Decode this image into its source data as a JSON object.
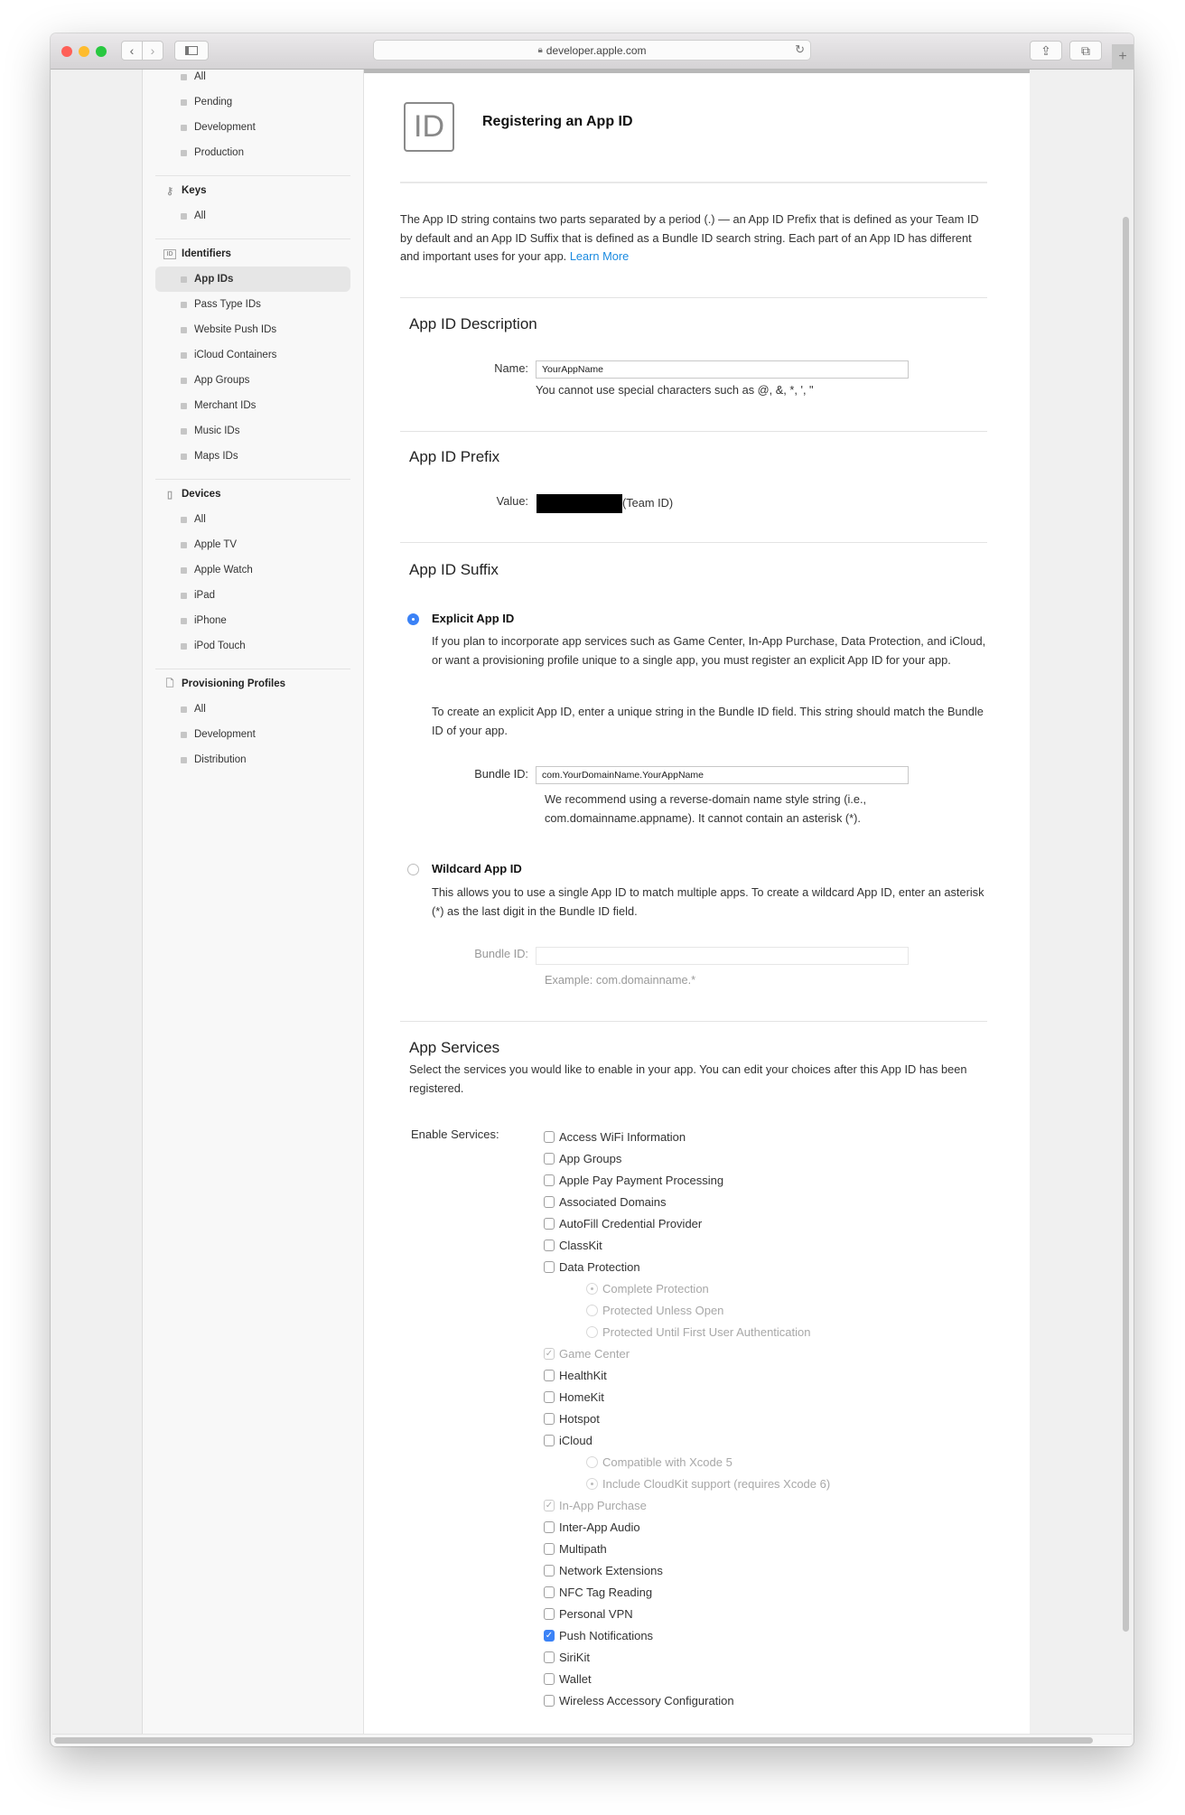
{
  "browser": {
    "url": "developer.apple.com",
    "lock_icon": "lock-icon",
    "colors": {
      "close": "#fe5f57",
      "minimize": "#febc2e",
      "zoom": "#28c840"
    }
  },
  "sidebar": {
    "top_items": [
      "All",
      "Pending",
      "Development",
      "Production"
    ],
    "sections": [
      {
        "title": "Keys",
        "icon": "key-icon",
        "items": [
          "All"
        ]
      },
      {
        "title": "Identifiers",
        "icon": "id-icon",
        "items": [
          "App IDs",
          "Pass Type IDs",
          "Website Push IDs",
          "iCloud Containers",
          "App Groups",
          "Merchant IDs",
          "Music IDs",
          "Maps IDs"
        ],
        "active": "App IDs"
      },
      {
        "title": "Devices",
        "icon": "device-icon",
        "items": [
          "All",
          "Apple TV",
          "Apple Watch",
          "iPad",
          "iPhone",
          "iPod Touch"
        ]
      },
      {
        "title": "Provisioning Profiles",
        "icon": "document-icon",
        "items": [
          "All",
          "Development",
          "Distribution"
        ]
      }
    ]
  },
  "main": {
    "icon_text": "ID",
    "title": "Registering an App ID",
    "intro": "The App ID string contains two parts separated by a period (.) — an App ID Prefix that is defined as your Team ID by default and an App ID Suffix that is defined as a Bundle ID search string. Each part of an App ID has different and important uses for your app.",
    "learn_more": "Learn More",
    "description": {
      "heading": "App ID Description",
      "name_label": "Name:",
      "name_value": "YourAppName",
      "hint": "You cannot use special characters such as @, &, *, ', \""
    },
    "prefix": {
      "heading": "App ID Prefix",
      "value_label": "Value:",
      "team_suffix": "(Team ID)"
    },
    "suffix": {
      "heading": "App ID Suffix",
      "explicit": {
        "label": "Explicit App ID",
        "selected": true,
        "para1": "If you plan to incorporate app services such as Game Center, In-App Purchase, Data Protection, and iCloud, or want a provisioning profile unique to a single app, you must register an explicit App ID for your app.",
        "para2": "To create an explicit App ID, enter a unique string in the Bundle ID field. This string should match the Bundle ID of your app.",
        "bundle_label": "Bundle ID:",
        "bundle_value": "com.YourDomainName.YourAppName",
        "hint": "We recommend using a reverse-domain name style string (i.e., com.domainname.appname). It cannot contain an asterisk (*)."
      },
      "wildcard": {
        "label": "Wildcard App ID",
        "selected": false,
        "para": "This allows you to use a single App ID to match multiple apps. To create a wildcard App ID, enter an asterisk (*) as the last digit in the Bundle ID field.",
        "bundle_label": "Bundle ID:",
        "bundle_value": "",
        "example": "Example: com.domainname.*"
      }
    },
    "services": {
      "heading": "App Services",
      "description": "Select the services you would like to enable in your app. You can edit your choices after this App ID has been registered.",
      "enable_label": "Enable Services:",
      "items": [
        {
          "label": "Access WiFi Information",
          "type": "checkbox",
          "checked": false,
          "disabled": false
        },
        {
          "label": "App Groups",
          "type": "checkbox",
          "checked": false,
          "disabled": false
        },
        {
          "label": "Apple Pay Payment Processing",
          "type": "checkbox",
          "checked": false,
          "disabled": false
        },
        {
          "label": "Associated Domains",
          "type": "checkbox",
          "checked": false,
          "disabled": false
        },
        {
          "label": "AutoFill Credential Provider",
          "type": "checkbox",
          "checked": false,
          "disabled": false
        },
        {
          "label": "ClassKit",
          "type": "checkbox",
          "checked": false,
          "disabled": false
        },
        {
          "label": "Data Protection",
          "type": "checkbox",
          "checked": false,
          "disabled": false
        },
        {
          "label": "Complete Protection",
          "type": "radio",
          "checked": true,
          "disabled": true
        },
        {
          "label": "Protected Unless Open",
          "type": "radio",
          "checked": false,
          "disabled": true
        },
        {
          "label": "Protected Until First User Authentication",
          "type": "radio",
          "checked": false,
          "disabled": true
        },
        {
          "label": "Game Center",
          "type": "checkbox",
          "checked": true,
          "disabled": true
        },
        {
          "label": "HealthKit",
          "type": "checkbox",
          "checked": false,
          "disabled": false
        },
        {
          "label": "HomeKit",
          "type": "checkbox",
          "checked": false,
          "disabled": false
        },
        {
          "label": "Hotspot",
          "type": "checkbox",
          "checked": false,
          "disabled": false
        },
        {
          "label": "iCloud",
          "type": "checkbox",
          "checked": false,
          "disabled": false
        },
        {
          "label": "Compatible with Xcode 5",
          "type": "radio",
          "checked": false,
          "disabled": true
        },
        {
          "label": "Include CloudKit support (requires Xcode 6)",
          "type": "radio",
          "checked": true,
          "disabled": true
        },
        {
          "label": "In-App Purchase",
          "type": "checkbox",
          "checked": true,
          "disabled": true
        },
        {
          "label": "Inter-App Audio",
          "type": "checkbox",
          "checked": false,
          "disabled": false
        },
        {
          "label": "Multipath",
          "type": "checkbox",
          "checked": false,
          "disabled": false
        },
        {
          "label": "Network Extensions",
          "type": "checkbox",
          "checked": false,
          "disabled": false
        },
        {
          "label": "NFC Tag Reading",
          "type": "checkbox",
          "checked": false,
          "disabled": false
        },
        {
          "label": "Personal VPN",
          "type": "checkbox",
          "checked": false,
          "disabled": false
        },
        {
          "label": "Push Notifications",
          "type": "checkbox",
          "checked": true,
          "disabled": false
        },
        {
          "label": "SiriKit",
          "type": "checkbox",
          "checked": false,
          "disabled": false
        },
        {
          "label": "Wallet",
          "type": "checkbox",
          "checked": false,
          "disabled": false
        },
        {
          "label": "Wireless Accessory Configuration",
          "type": "checkbox",
          "checked": false,
          "disabled": false
        }
      ]
    }
  }
}
